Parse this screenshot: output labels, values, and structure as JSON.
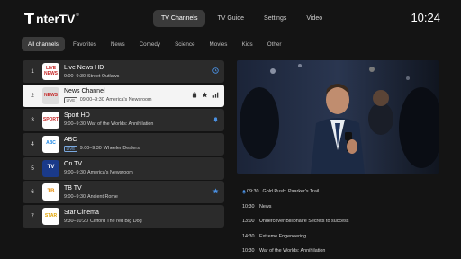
{
  "brand": {
    "name": "nterTV",
    "reg": "®"
  },
  "topnav": {
    "tabs": [
      "TV Channels",
      "TV Guide",
      "Settings",
      "Video"
    ]
  },
  "clock": "10:24",
  "categories": [
    "All channels",
    "Favorites",
    "News",
    "Comedy",
    "Science",
    "Movies",
    "Kids",
    "Other"
  ],
  "channels": [
    {
      "num": "1",
      "name": "Live News HD",
      "time": "9:00–9:30",
      "program": "Street Outlaws",
      "live": "",
      "logo": "LIVE NEWS"
    },
    {
      "num": "2",
      "name": "News Channel",
      "time": "09:00–9:30",
      "program": "America's Newsroom",
      "live": "LIVE",
      "logo": "NEWS"
    },
    {
      "num": "3",
      "name": "Sport HD",
      "time": "9:00–9:30",
      "program": "War of the Worlds: Annihilation",
      "live": "",
      "logo": "SPORT"
    },
    {
      "num": "4",
      "name": "ABC",
      "time": "9:00–9:30",
      "program": "Wheeler Dealers",
      "live": "LIVE",
      "logo": "ABC"
    },
    {
      "num": "5",
      "name": "On TV",
      "time": "9:00–9:30",
      "program": "America's Newsroom",
      "live": "",
      "logo": "TV"
    },
    {
      "num": "6",
      "name": "TB TV",
      "time": "9:00–9:30",
      "program": "Ancient Rome",
      "live": "",
      "logo": "TB"
    },
    {
      "num": "7",
      "name": "Star Cinema",
      "time": "9:30–10:20",
      "program": "Clifford The red Big Dog",
      "live": "",
      "logo": "STAR"
    }
  ],
  "schedule": [
    {
      "time": "09:30",
      "title": "Gold Rush: Paarker's Trail",
      "reminder": true
    },
    {
      "time": "10:30",
      "title": "News",
      "reminder": false
    },
    {
      "time": "13:00",
      "title": "Undercover Billionaire Secrets to success",
      "reminder": false
    },
    {
      "time": "14:30",
      "title": "Extreme Engeneering",
      "reminder": false
    },
    {
      "time": "10:30",
      "title": "War of the Worlds: Annihilation",
      "reminder": false
    }
  ],
  "icons": {
    "row1": [
      "history-icon"
    ],
    "row2": [
      "lock-icon",
      "star-icon",
      "signal-bars-icon"
    ],
    "row3": [
      "bell-icon"
    ],
    "row6": [
      "star-icon"
    ],
    "schedule": [
      "bell-icon"
    ]
  },
  "colors": {
    "accent": "#4a90e2",
    "selected_row": "#f4f4f4",
    "row": "#2b2b2b",
    "background": "#141414"
  }
}
